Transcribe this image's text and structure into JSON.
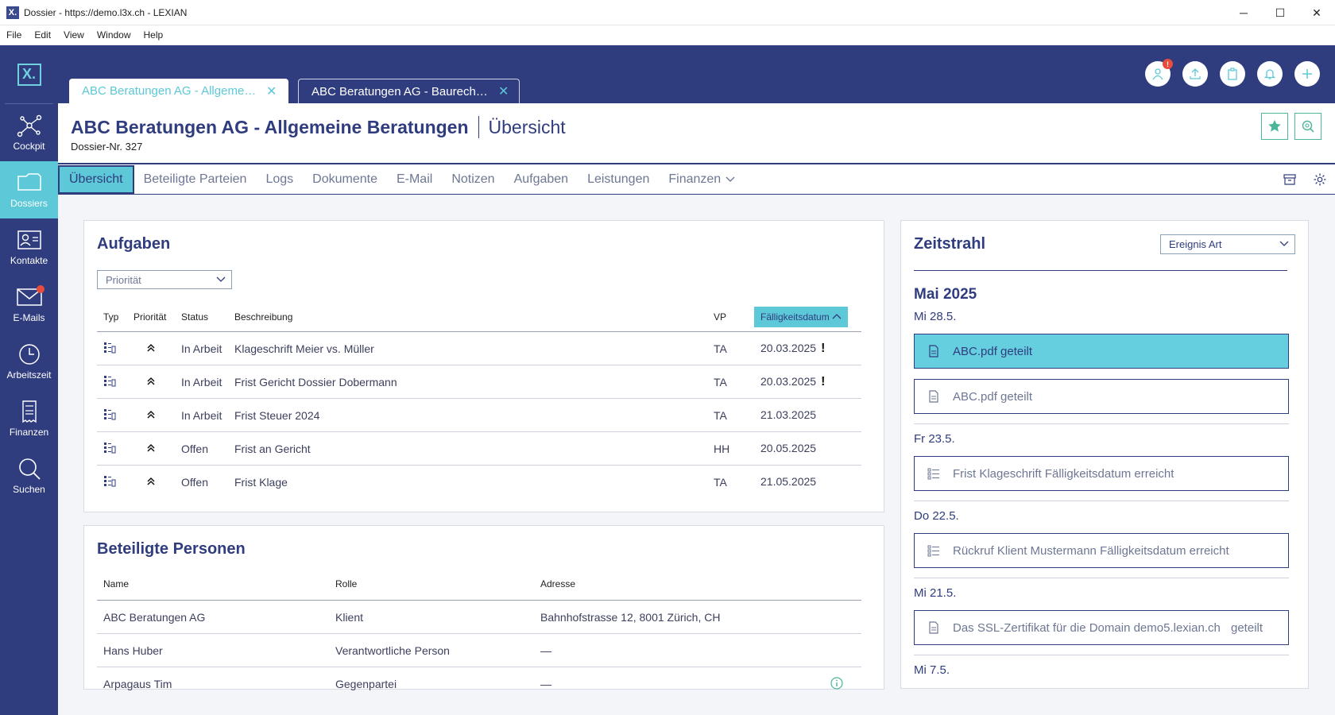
{
  "window": {
    "title": "Dossier - https://demo.l3x.ch - LEXIAN",
    "logo": "X.",
    "minimize": "─",
    "maximize": "☐",
    "close": "✕"
  },
  "menu": [
    "File",
    "Edit",
    "View",
    "Window",
    "Help"
  ],
  "sidebar": {
    "logo": "X.",
    "items": [
      {
        "label": "Cockpit",
        "icon": "network-icon"
      },
      {
        "label": "Dossiers",
        "icon": "folder-icon"
      },
      {
        "label": "Kontakte",
        "icon": "contact-card-icon"
      },
      {
        "label": "E-Mails",
        "icon": "mail-icon"
      },
      {
        "label": "Arbeitszeit",
        "icon": "clock-icon"
      },
      {
        "label": "Finanzen",
        "icon": "invoice-icon"
      },
      {
        "label": "Suchen",
        "icon": "search-icon"
      }
    ]
  },
  "tabs": [
    {
      "label": "ABC Beratungen AG - Allgemeine Beratungen"
    },
    {
      "label": "ABC Beratungen AG - Baurecht Beratung"
    }
  ],
  "header_badge": "!",
  "dossier": {
    "title": "ABC Beratungen AG - Allgemeine Beratungen",
    "subtitle": "Übersicht",
    "number": "Dossier-Nr. 327"
  },
  "nav": {
    "items": [
      "Übersicht",
      "Beteiligte Parteien",
      "Logs",
      "Dokumente",
      "E-Mail",
      "Notizen",
      "Aufgaben",
      "Leistungen",
      "Finanzen"
    ]
  },
  "aufgaben": {
    "title": "Aufgaben",
    "filter_placeholder": "Priorität",
    "headers": {
      "typ": "Typ",
      "prioritaet": "Priorität",
      "status": "Status",
      "beschreibung": "Beschreibung",
      "vp": "VP",
      "faellig": "Fälligkeitsdatum"
    },
    "rows": [
      {
        "status": "In Arbeit",
        "beschreibung": "Klageschrift Meier vs. Müller",
        "vp": "TA",
        "faellig": "20.03.2025",
        "flag": "!"
      },
      {
        "status": "In Arbeit",
        "beschreibung": "Frist Gericht Dossier Dobermann",
        "vp": "TA",
        "faellig": "20.03.2025",
        "flag": "!"
      },
      {
        "status": "In Arbeit",
        "beschreibung": "Frist Steuer 2024",
        "vp": "TA",
        "faellig": "21.03.2025",
        "flag": ""
      },
      {
        "status": "Offen",
        "beschreibung": "Frist an Gericht",
        "vp": "HH",
        "faellig": "20.05.2025",
        "flag": ""
      },
      {
        "status": "Offen",
        "beschreibung": "Frist Klage",
        "vp": "TA",
        "faellig": "21.05.2025",
        "flag": ""
      }
    ]
  },
  "personen": {
    "title": "Beteiligte Personen",
    "headers": {
      "name": "Name",
      "rolle": "Rolle",
      "adresse": "Adresse"
    },
    "rows": [
      {
        "name": "ABC Beratungen AG",
        "rolle": "Klient",
        "adresse": "Bahnhofstrasse 12, 8001 Zürich, CH"
      },
      {
        "name": "Hans Huber",
        "rolle": "Verantwortliche Person",
        "adresse": "—"
      },
      {
        "name": "Arpagaus Tim",
        "rolle": "Gegenpartei",
        "adresse": "—"
      }
    ]
  },
  "zeitstrahl": {
    "title": "Zeitstrahl",
    "filter_label": "Ereignis Art",
    "month": "Mai 2025",
    "days": [
      {
        "label": "Mi 28.5."
      },
      {
        "label": "Fr 23.5."
      },
      {
        "label": "Do 22.5."
      },
      {
        "label": "Mi 21.5."
      },
      {
        "label": "Mi 7.5."
      }
    ],
    "events": [
      {
        "text": "ABC.pdf geteilt",
        "icon": "document-icon"
      },
      {
        "text": "ABC.pdf geteilt",
        "icon": "document-icon"
      },
      {
        "text": "Frist Klageschrift Fälligkeitsdatum erreicht",
        "icon": "task-list-icon"
      },
      {
        "text": "Rückruf Klient Mustermann Fälligkeitsdatum erreicht",
        "icon": "task-list-icon"
      },
      {
        "text": "Das SSL-Zertifikat für die Domain demo5.lexian.ch",
        "suffix": "geteilt",
        "icon": "document-icon"
      }
    ]
  },
  "colors": {
    "primary": "#2f3c7e",
    "accent": "#5cc8d8",
    "green": "#4cb59a",
    "alert": "#e74c3c"
  }
}
